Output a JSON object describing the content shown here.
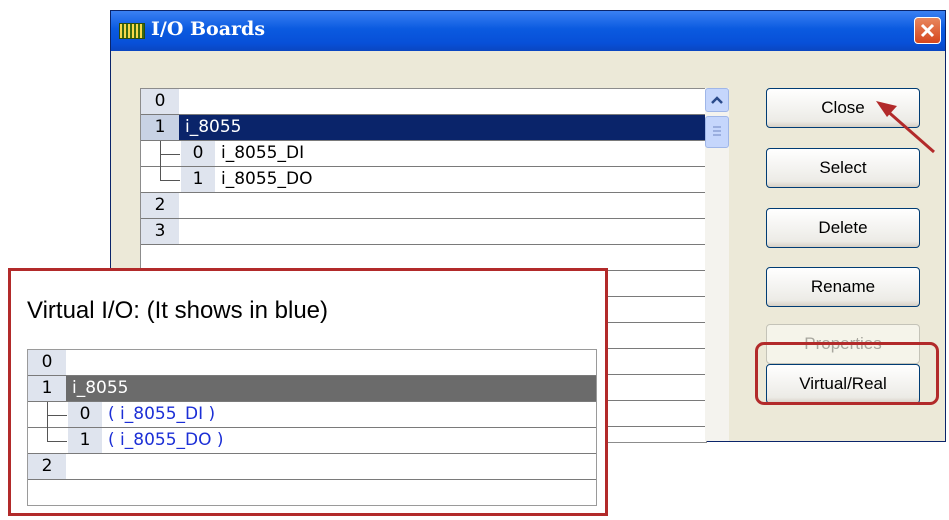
{
  "dialog": {
    "title": "I/O Boards",
    "rows": [
      {
        "num": "0",
        "name": ""
      },
      {
        "num": "1",
        "name": "i_8055"
      },
      {
        "num": "0",
        "name": "i_8055_DI"
      },
      {
        "num": "1",
        "name": "i_8055_DO"
      },
      {
        "num": "2",
        "name": ""
      },
      {
        "num": "3",
        "name": ""
      }
    ],
    "buttons": {
      "close": "Close",
      "select": "Select",
      "delete": "Delete",
      "rename": "Rename",
      "properties": "Properties",
      "virtual_real": "Virtual/Real"
    }
  },
  "overlay": {
    "label": "Virtual I/O:  (It shows in blue)",
    "rows": [
      {
        "num": "0",
        "name": ""
      },
      {
        "num": "1",
        "name": "i_8055"
      },
      {
        "num": "0",
        "name": "( i_8055_DI )"
      },
      {
        "num": "1",
        "name": "( i_8055_DO )"
      },
      {
        "num": "2",
        "name": ""
      }
    ]
  },
  "colors": {
    "selection": "#0a246a",
    "virtual_text": "#1c2fd6",
    "highlight": "#b22a2a"
  }
}
